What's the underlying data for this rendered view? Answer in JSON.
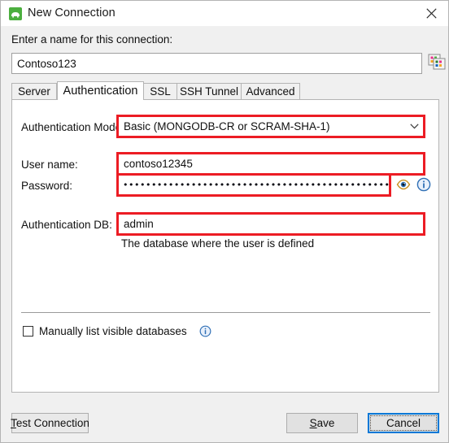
{
  "window": {
    "title": "New Connection",
    "icon": "mongodb-leaf-icon",
    "close_icon": "close-icon",
    "accent": "#0078d7",
    "highlight_color": "#ec1c24",
    "brand_green": "#4caf3f"
  },
  "name_section": {
    "label": "Enter a name for this connection:",
    "value": "Contoso123",
    "placeholder": "",
    "picker_icon": "color-palette-icon"
  },
  "tabs": [
    {
      "label": "Server",
      "selected": false
    },
    {
      "label": "Authentication",
      "selected": true
    },
    {
      "label": "SSL",
      "selected": false
    },
    {
      "label": "SSH Tunnel",
      "selected": false
    },
    {
      "label": "Advanced",
      "selected": false
    }
  ],
  "auth": {
    "mode_label": "Authentication Mode:",
    "mode_value": "Basic (MONGODB-CR or SCRAM-SHA-1)",
    "mode_chevron_icon": "chevron-down-icon",
    "username_label": "User name:",
    "username_value": "contoso12345",
    "password_label": "Password:",
    "password_masked": "••••••••••••••••••••••••••••••••••••••••••••••••",
    "reveal_icon": "eye-icon",
    "password_info_icon": "info-icon",
    "authdb_label": "Authentication DB:",
    "authdb_value": "admin",
    "authdb_hint": "The database where the user is defined",
    "manual_list_label": "Manually list visible databases",
    "manual_list_checked": false,
    "manual_list_info_icon": "info-icon"
  },
  "footer": {
    "test_connection": {
      "pre": "",
      "accel": "T",
      "post": "est Connection"
    },
    "save": {
      "pre": "",
      "accel": "S",
      "post": "ave"
    },
    "cancel": {
      "pre": "",
      "accel": "",
      "post": "Cancel"
    }
  }
}
